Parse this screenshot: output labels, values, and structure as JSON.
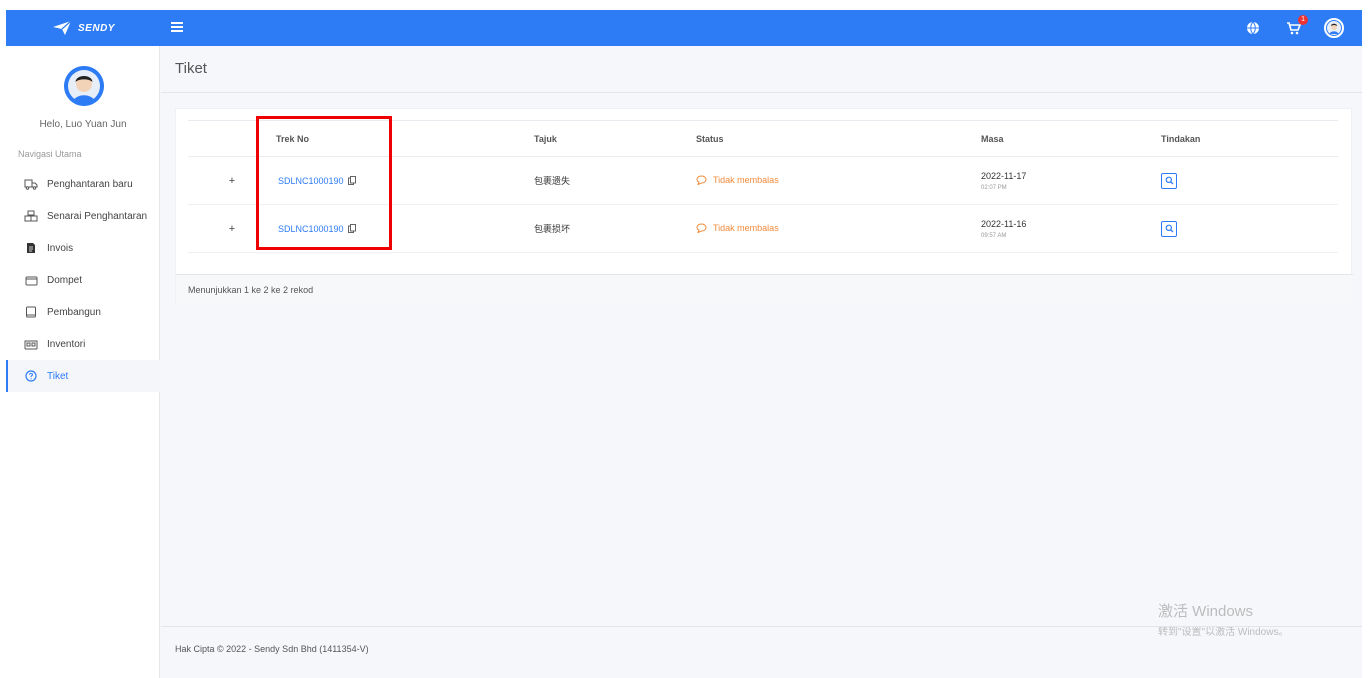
{
  "brand": {
    "name": "SENDY"
  },
  "topbar": {
    "cart_count": "1"
  },
  "sidebar": {
    "greeting": "Helo, Luo Yuan Jun",
    "nav_title": "Navigasi Utama",
    "items": [
      {
        "label": "Penghantaran baru",
        "icon": "truck-icon"
      },
      {
        "label": "Senarai Penghantaran",
        "icon": "boxes-icon"
      },
      {
        "label": "Invois",
        "icon": "invoice-icon"
      },
      {
        "label": "Dompet",
        "icon": "wallet-icon"
      },
      {
        "label": "Pembangun",
        "icon": "book-icon"
      },
      {
        "label": "Inventori",
        "icon": "warehouse-icon"
      },
      {
        "label": "Tiket",
        "icon": "question-circle-icon",
        "active": true
      }
    ]
  },
  "main": {
    "title": "Tiket",
    "table": {
      "headers": {
        "trek": "Trek No",
        "tajuk": "Tajuk",
        "status": "Status",
        "masa": "Masa",
        "tindakan": "Tindakan"
      },
      "rows": [
        {
          "expand": "+",
          "trek": "SDLNC1000190",
          "tajuk": "包裹遗失",
          "status": "Tidak membalas",
          "date": "2022-11-17",
          "time": "02:07 PM"
        },
        {
          "expand": "+",
          "trek": "SDLNC1000190",
          "tajuk": "包裹损坏",
          "status": "Tidak membalas",
          "date": "2022-11-16",
          "time": "09:57 AM"
        }
      ]
    },
    "records_info": "Menunjukkan 1 ke 2 ke 2 rekod"
  },
  "footer": {
    "copyright": "Hak Cipta © 2022 - Sendy Sdn Bhd (1411354-V)"
  },
  "watermark": {
    "title": "激活 Windows",
    "subtitle": "转到\"设置\"以激活 Windows。"
  },
  "colors": {
    "primary": "#2d7cf6",
    "status_orange": "#f08b3c",
    "highlight_red": "#ee0000"
  }
}
